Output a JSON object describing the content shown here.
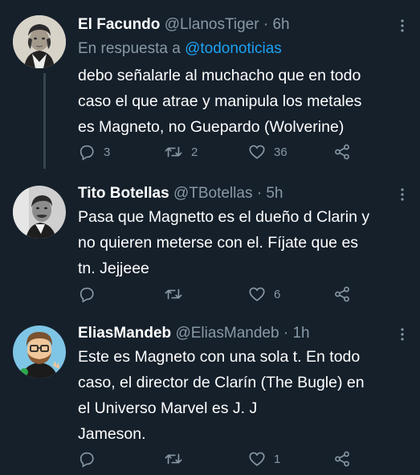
{
  "tweets": [
    {
      "name": "El Facundo",
      "handle": "@LlanosTiger",
      "separator": "·",
      "time": "6h",
      "reply_prefix": "En respuesta a",
      "reply_mention": "@todonoticias",
      "lines": [
        "debo señalarle al muchacho que en todo",
        "caso el que atrae y manipula los metales",
        "es Magneto, no Guepardo (Wolverine)"
      ],
      "reply_count": "3",
      "retweet_count": "2",
      "like_count": "36"
    },
    {
      "name": "Tito Botellas",
      "handle": "@TBotellas",
      "separator": "·",
      "time": "5h",
      "lines": [
        "Pasa que Magnetto es el dueño d Clarin y",
        "no quieren meterse con el. Fíjate que es",
        "tn. Jejjeee"
      ],
      "reply_count": "",
      "retweet_count": "",
      "like_count": "6"
    },
    {
      "name": "EliasMandeb",
      "handle": "@EliasMandeb",
      "separator": "·",
      "time": "1h",
      "lines": [
        "Este es Magneto con una sola t. En todo",
        "caso, el director de Clarín (The Bugle) en",
        "el Universo Marvel es J. J",
        "Jameson."
      ],
      "reply_count": "",
      "retweet_count": "",
      "like_count": "1"
    }
  ],
  "icons": {
    "reply": "reply-icon",
    "retweet": "retweet-icon",
    "like": "heart-icon",
    "share": "share-icon",
    "more": "more-vertical-icon"
  },
  "colors": {
    "background": "#15202b",
    "text": "#ffffff",
    "secondary": "#8899a6",
    "link": "#1da1f2",
    "thread_line": "#38444d"
  }
}
